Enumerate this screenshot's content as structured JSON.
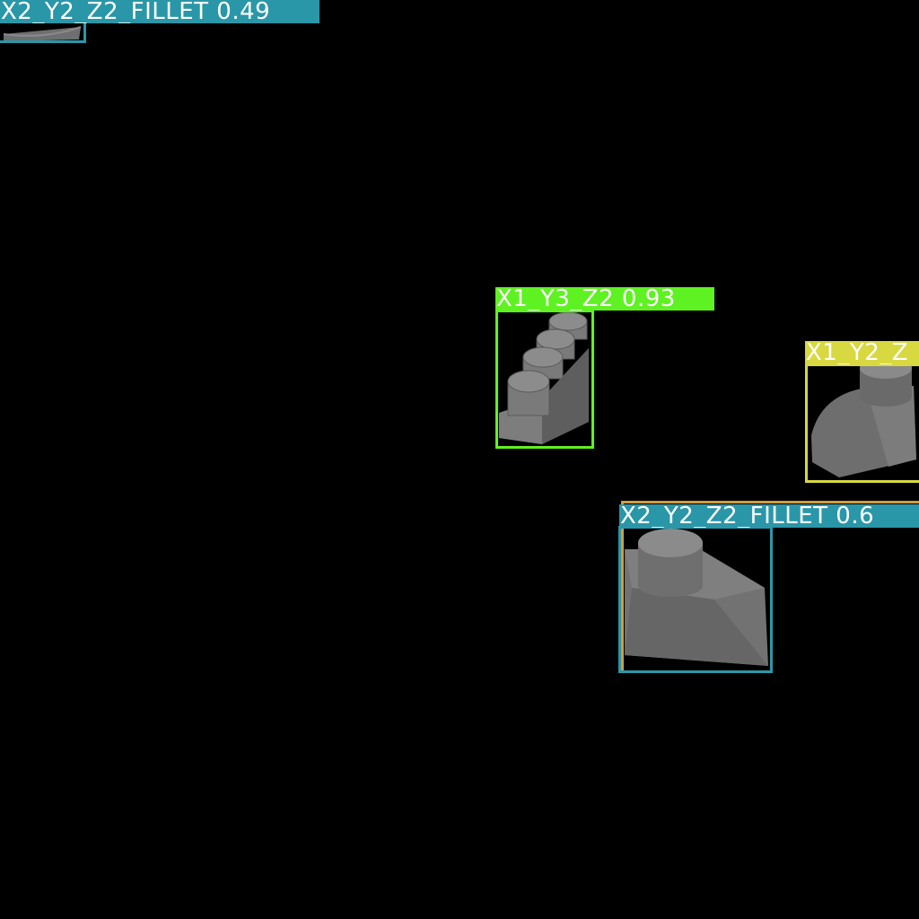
{
  "colors": {
    "background": "#000000",
    "teal": "#2a97a8",
    "green": "#5ff222",
    "yellow": "#d8d840",
    "orange": "#d89a3a",
    "brick_light": "#8a8a8a",
    "brick_mid": "#707070",
    "brick_dark": "#565656"
  },
  "detections": [
    {
      "label": "X2_Y2_Z2_FILLET 0.49",
      "class": "X2_Y2_Z2_FILLET",
      "confidence": 0.49,
      "color": "teal"
    },
    {
      "label": "X1_Y3_Z2 0.93",
      "class": "X1_Y3_Z2",
      "confidence": 0.93,
      "color": "green"
    },
    {
      "label": "X1_Y2_Z",
      "color": "yellow"
    },
    {
      "label": "X2_Y2_Z2_FILLET 0.6",
      "color": "teal"
    }
  ]
}
